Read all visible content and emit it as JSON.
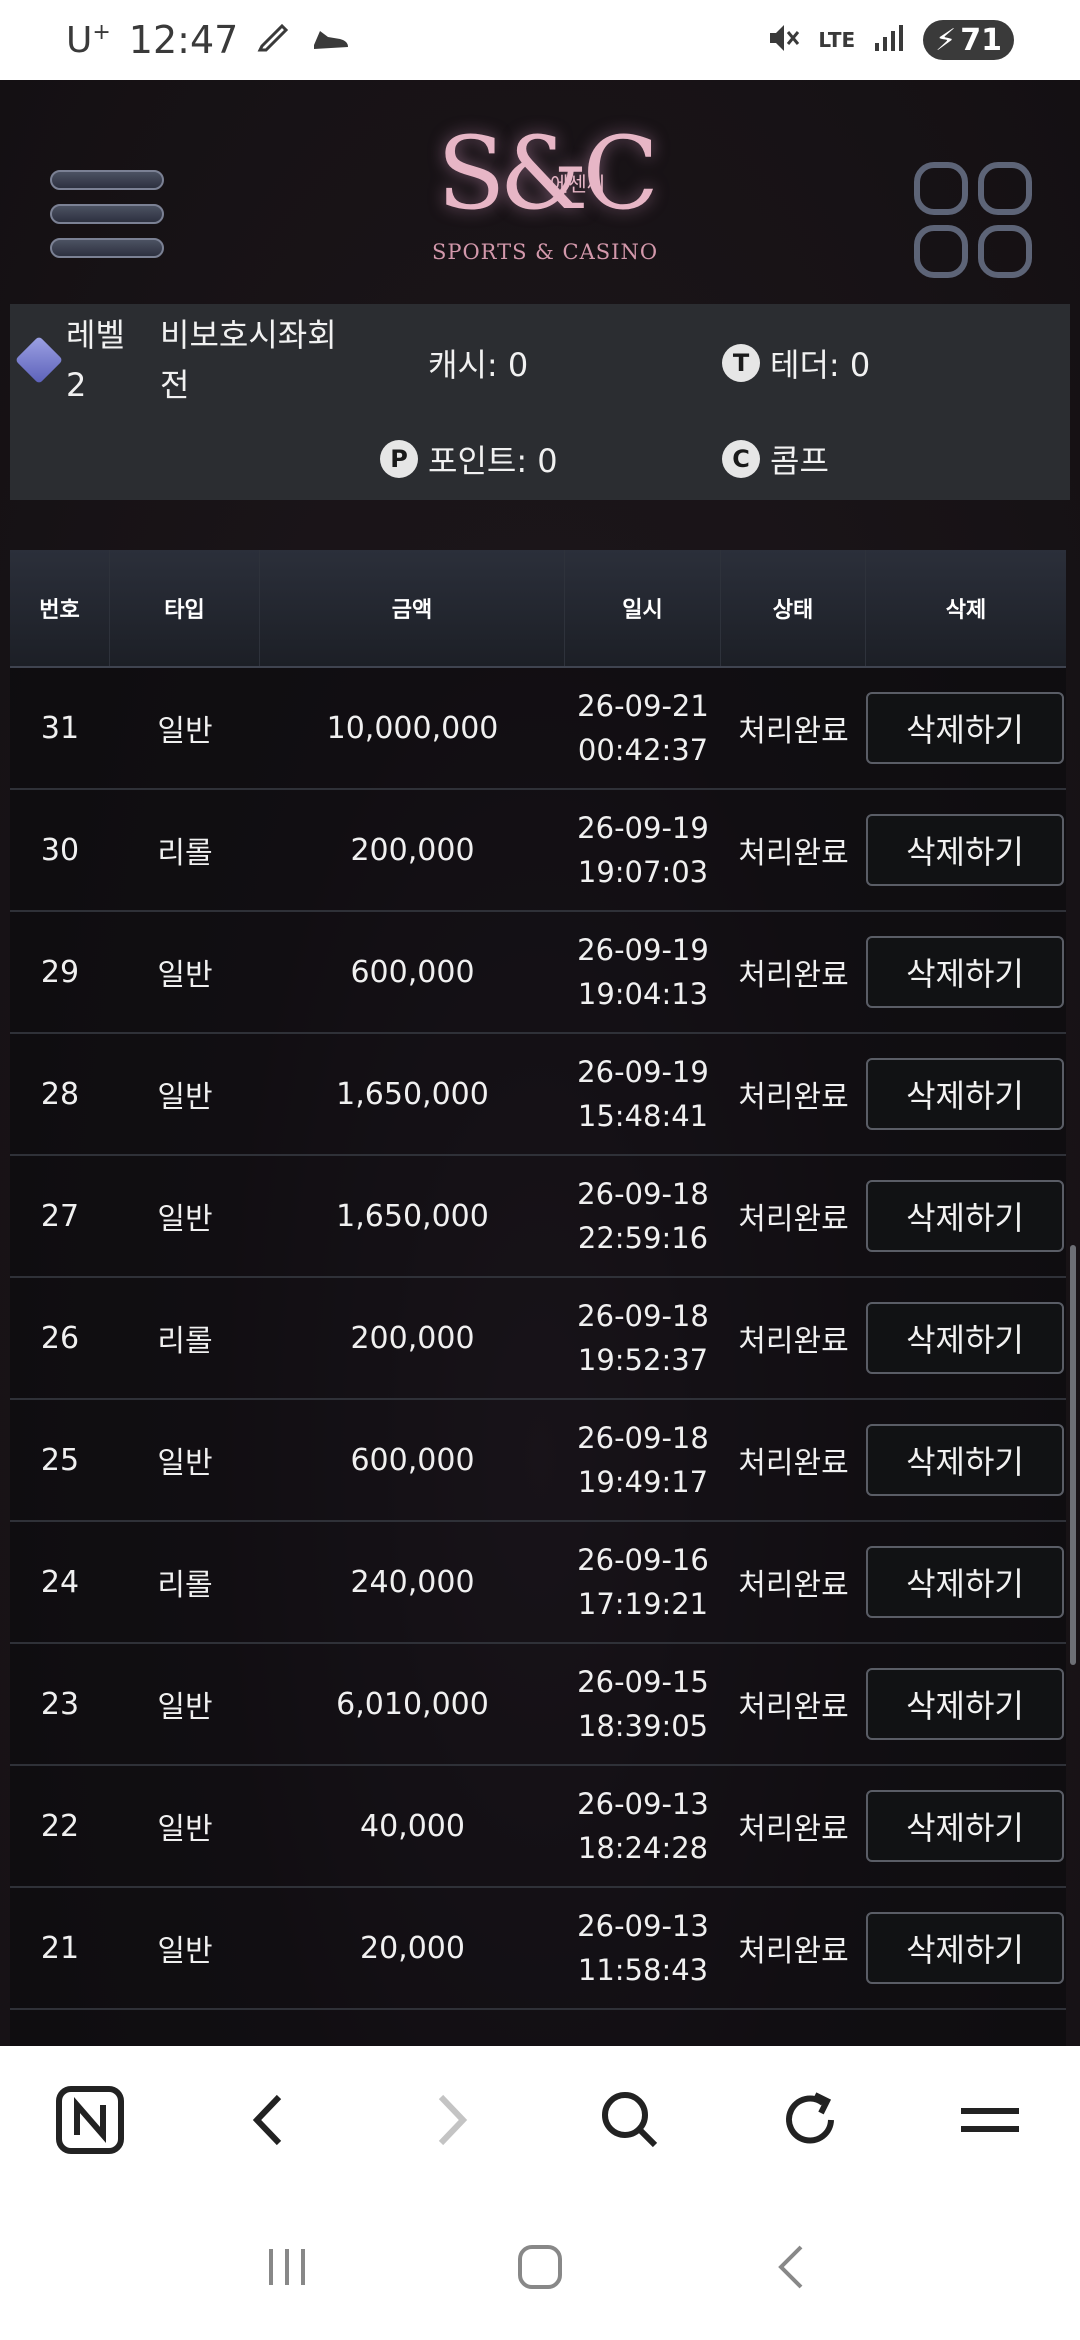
{
  "status_bar": {
    "carrier": "U",
    "carrier_sup": "+",
    "time": "12:47",
    "network": "LTE",
    "battery": "71"
  },
  "brand": {
    "mark": "S&C",
    "korean": "에센씨",
    "subtitle": "SPORTS & CASINO"
  },
  "user": {
    "level_label": "레벨",
    "level_value": "2",
    "account_status": "비보호시좌회전",
    "cash": "캐시: 0",
    "tether": "테더: 0",
    "point": "포인트: 0",
    "comp": "콤프",
    "tether_icon": "T",
    "point_icon": "P",
    "comp_icon": "C"
  },
  "table": {
    "headers": [
      "번호",
      "타입",
      "금액",
      "일시",
      "상태",
      "삭제"
    ],
    "rows": [
      {
        "no": "31",
        "type": "일반",
        "amount": "10,000,000",
        "date": "26-09-21",
        "time": "00:42:37",
        "status": "처리완료",
        "action": "삭제하기"
      },
      {
        "no": "30",
        "type": "리롤",
        "amount": "200,000",
        "date": "26-09-19",
        "time": "19:07:03",
        "status": "처리완료",
        "action": "삭제하기"
      },
      {
        "no": "29",
        "type": "일반",
        "amount": "600,000",
        "date": "26-09-19",
        "time": "19:04:13",
        "status": "처리완료",
        "action": "삭제하기"
      },
      {
        "no": "28",
        "type": "일반",
        "amount": "1,650,000",
        "date": "26-09-19",
        "time": "15:48:41",
        "status": "처리완료",
        "action": "삭제하기"
      },
      {
        "no": "27",
        "type": "일반",
        "amount": "1,650,000",
        "date": "26-09-18",
        "time": "22:59:16",
        "status": "처리완료",
        "action": "삭제하기"
      },
      {
        "no": "26",
        "type": "리롤",
        "amount": "200,000",
        "date": "26-09-18",
        "time": "19:52:37",
        "status": "처리완료",
        "action": "삭제하기"
      },
      {
        "no": "25",
        "type": "일반",
        "amount": "600,000",
        "date": "26-09-18",
        "time": "19:49:17",
        "status": "처리완료",
        "action": "삭제하기"
      },
      {
        "no": "24",
        "type": "리롤",
        "amount": "240,000",
        "date": "26-09-16",
        "time": "17:19:21",
        "status": "처리완료",
        "action": "삭제하기"
      },
      {
        "no": "23",
        "type": "일반",
        "amount": "6,010,000",
        "date": "26-09-15",
        "time": "18:39:05",
        "status": "처리완료",
        "action": "삭제하기"
      },
      {
        "no": "22",
        "type": "일반",
        "amount": "40,000",
        "date": "26-09-13",
        "time": "18:24:28",
        "status": "처리완료",
        "action": "삭제하기"
      },
      {
        "no": "21",
        "type": "일반",
        "amount": "20,000",
        "date": "26-09-13",
        "time": "11:58:43",
        "status": "처리완료",
        "action": "삭제하기"
      }
    ]
  },
  "toolbar_icons": [
    "naver-home-icon",
    "back-icon",
    "forward-icon",
    "search-icon",
    "refresh-icon",
    "menu-icon"
  ],
  "nav_icons": [
    "recent-apps-icon",
    "home-icon",
    "system-back-icon"
  ],
  "colors": {
    "app_bg": "#1b1519",
    "panel_bg": "#2b2d31",
    "logo_pink": "#e7b6c6"
  }
}
